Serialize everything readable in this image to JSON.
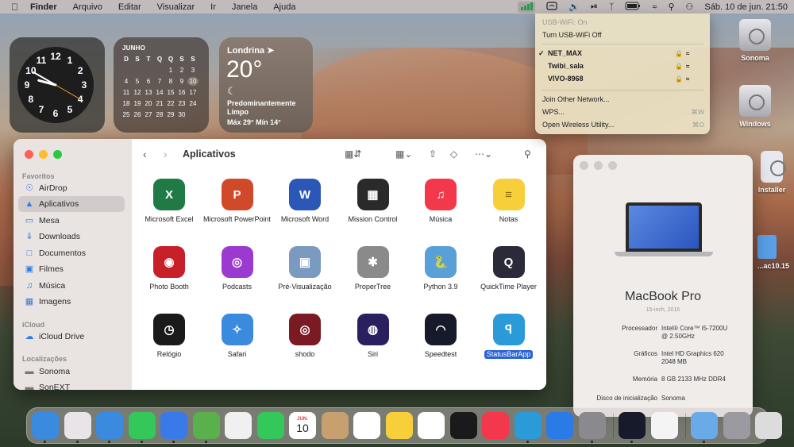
{
  "menubar": {
    "app": "Finder",
    "items": [
      "Arquivo",
      "Editar",
      "Visualizar",
      "Ir",
      "Janela",
      "Ajuda"
    ],
    "datetime": "Sáb. 10 de jun.  21:50"
  },
  "clock_widget": {
    "numbers": [
      "12",
      "1",
      "2",
      "3",
      "4",
      "5",
      "6",
      "7",
      "8",
      "9",
      "10",
      "11"
    ]
  },
  "calendar_widget": {
    "month": "JUNHO",
    "weekdays": [
      "D",
      "S",
      "T",
      "Q",
      "Q",
      "S",
      "S"
    ],
    "days": [
      "",
      "",
      "",
      "",
      "1",
      "2",
      "3",
      "4",
      "5",
      "6",
      "7",
      "8",
      "9",
      "10",
      "11",
      "12",
      "13",
      "14",
      "15",
      "16",
      "17",
      "18",
      "19",
      "20",
      "21",
      "22",
      "23",
      "24",
      "25",
      "26",
      "27",
      "28",
      "29",
      "30"
    ],
    "today": "10"
  },
  "weather_widget": {
    "city": "Londrina",
    "temp": "20°",
    "condition_line1": "Predominantemente",
    "condition_line2": "Limpo",
    "high_low": "Máx 29° Mín 14°"
  },
  "finder": {
    "title": "Aplicativos",
    "sidebar": {
      "favorites_label": "Favoritos",
      "favorites": [
        "AirDrop",
        "Aplicativos",
        "Mesa",
        "Downloads",
        "Documentos",
        "Filmes",
        "Música",
        "Imagens"
      ],
      "icloud_label": "iCloud",
      "icloud": [
        "iCloud Drive"
      ],
      "locations_label": "Localizações",
      "locations": [
        "Sonoma",
        "SonEXT"
      ]
    },
    "apps": [
      {
        "name": "Microsoft Excel",
        "color": "#1f7a45",
        "glyph": "X"
      },
      {
        "name": "Microsoft PowerPoint",
        "color": "#d04a2a",
        "glyph": "P"
      },
      {
        "name": "Microsoft Word",
        "color": "#2b57b6",
        "glyph": "W"
      },
      {
        "name": "Mission Control",
        "color": "#2a2a2a",
        "glyph": "▦"
      },
      {
        "name": "Música",
        "color": "#f2384a",
        "glyph": "♫"
      },
      {
        "name": "Notas",
        "color": "#f6cf3a",
        "glyph": "≡"
      },
      {
        "name": "Photo Booth",
        "color": "#c8202a",
        "glyph": "◉"
      },
      {
        "name": "Podcasts",
        "color": "#9a3ad0",
        "glyph": "◎"
      },
      {
        "name": "Pré-Visualização",
        "color": "#7a9ac0",
        "glyph": "▣"
      },
      {
        "name": "ProperTree",
        "color": "#8a8a8a",
        "glyph": "✱"
      },
      {
        "name": "Python 3.9",
        "color": "#5aa0d8",
        "glyph": "🐍"
      },
      {
        "name": "QuickTime Player",
        "color": "#2a2a3a",
        "glyph": "Q"
      },
      {
        "name": "Relógio",
        "color": "#1a1a1a",
        "glyph": "◷"
      },
      {
        "name": "Safari",
        "color": "#3a8ae0",
        "glyph": "✧"
      },
      {
        "name": "shodo",
        "color": "#7a1a22",
        "glyph": "◎"
      },
      {
        "name": "Siri",
        "color": "#2a2060",
        "glyph": "◍"
      },
      {
        "name": "Speedtest",
        "color": "#161a2a",
        "glyph": "◠"
      },
      {
        "name": "StatusBarApp",
        "color": "#2a9ad8",
        "glyph": "ꟼ"
      }
    ]
  },
  "wifi_menu": {
    "status": "USB-WiFi: On",
    "toggle": "Turn USB-WiFi Off",
    "networks": [
      {
        "name": "NET_MAX",
        "checked": "✓"
      },
      {
        "name": "Twibi_sala",
        "checked": ""
      },
      {
        "name": "VIVO-8968",
        "checked": ""
      }
    ],
    "other": "Join Other Network...",
    "wps": "WPS...",
    "wps_shortcut": "⌘W",
    "open_utility": "Open Wireless Utility...",
    "open_shortcut": "⌘O"
  },
  "about_mac": {
    "model": "MacBook Pro",
    "sub": "15-inch, 2016",
    "specs": [
      {
        "k": "Processador",
        "v": "Intel® Core™ i5-7200U @ 2.50GHz"
      },
      {
        "k": "Gráficos",
        "v": "Intel HD Graphics 620 2048 MB"
      },
      {
        "k": "Memória",
        "v": "8 GB 2133 MHz DDR4"
      },
      {
        "k": "Disco de inicialização",
        "v": "Sonoma"
      }
    ]
  },
  "desktop": {
    "icons": [
      "Sonoma",
      "Windows",
      "Installer",
      "...ac10.15"
    ]
  },
  "dock": {
    "calendar_month": "JUN.",
    "calendar_day": "10",
    "apps": [
      {
        "name": "finder",
        "color": "#3a8ae0"
      },
      {
        "name": "launchpad",
        "color": "#e8e4e8"
      },
      {
        "name": "safari",
        "color": "#3a8ae0"
      },
      {
        "name": "messages",
        "color": "#34c759"
      },
      {
        "name": "mail",
        "color": "#3a7ae8"
      },
      {
        "name": "maps",
        "color": "#5ab04a"
      },
      {
        "name": "photos",
        "color": "#f0f0f0"
      },
      {
        "name": "facetime",
        "color": "#34c759"
      },
      {
        "name": "calendar",
        "color": "#ffffff"
      },
      {
        "name": "contacts",
        "color": "#c8a070"
      },
      {
        "name": "reminders",
        "color": "#ffffff"
      },
      {
        "name": "notes",
        "color": "#f6cf3a"
      },
      {
        "name": "freeform",
        "color": "#ffffff"
      },
      {
        "name": "tv",
        "color": "#1a1a1a"
      },
      {
        "name": "music",
        "color": "#f2384a"
      },
      {
        "name": "statusbarapp",
        "color": "#2a9ad8"
      },
      {
        "name": "app-store",
        "color": "#2a7ae8"
      },
      {
        "name": "system-settings",
        "color": "#8a8a8e"
      },
      {
        "name": "speedtest",
        "color": "#161a2a"
      },
      {
        "name": "textedit",
        "color": "#f4f4f4"
      },
      {
        "name": "downloads",
        "color": "#6aaae8"
      },
      {
        "name": "disk-utility",
        "color": "#9a9aa0"
      },
      {
        "name": "trash",
        "color": "#dcdcdc"
      }
    ]
  }
}
